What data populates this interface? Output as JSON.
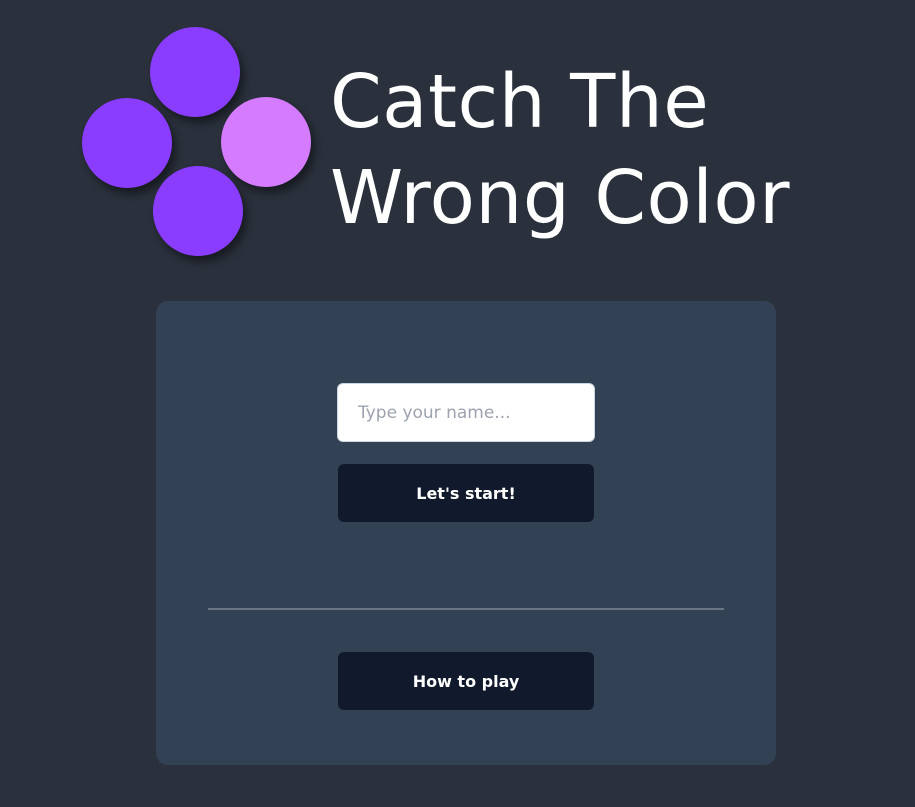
{
  "app": {
    "title_line1": "Catch The",
    "title_line2": "Wrong Color"
  },
  "logo": {
    "dots": [
      {
        "position": "top",
        "color": "#8b3dff"
      },
      {
        "position": "left",
        "color": "#8b3dff"
      },
      {
        "position": "right",
        "color": "#d57bff"
      },
      {
        "position": "bottom",
        "color": "#8b3dff"
      }
    ]
  },
  "form": {
    "name_value": "",
    "name_placeholder": "Type your name...",
    "start_label": "Let's start!"
  },
  "help": {
    "how_to_play_label": "How to play"
  },
  "colors": {
    "background": "#2a303c",
    "card": "#334155",
    "button": "#111a2c",
    "accent_purple": "#8b3dff",
    "accent_pink": "#d57bff"
  }
}
